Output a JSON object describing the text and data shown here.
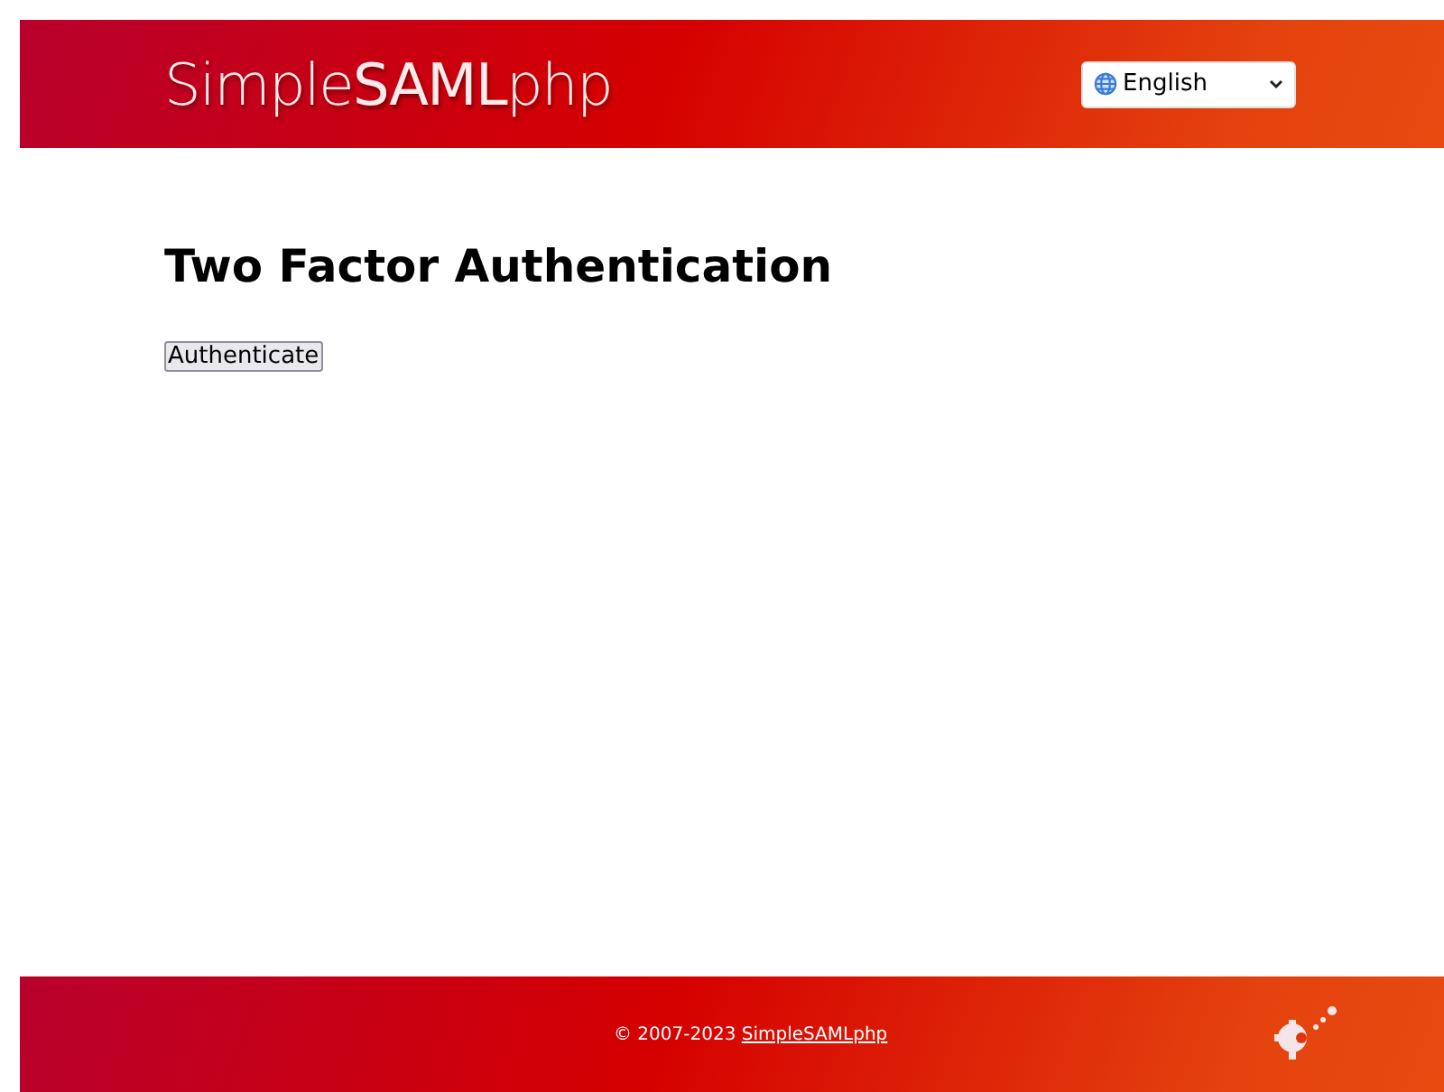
{
  "header": {
    "logo": "Simple**SAML**php",
    "language_select": {
      "value": "English"
    }
  },
  "main": {
    "title": "Two Factor Authentication",
    "button": "Authenticate"
  },
  "footer": {
    "copyright": "© 2007-2023",
    "link": "SimpleSAMLphp"
  }
}
